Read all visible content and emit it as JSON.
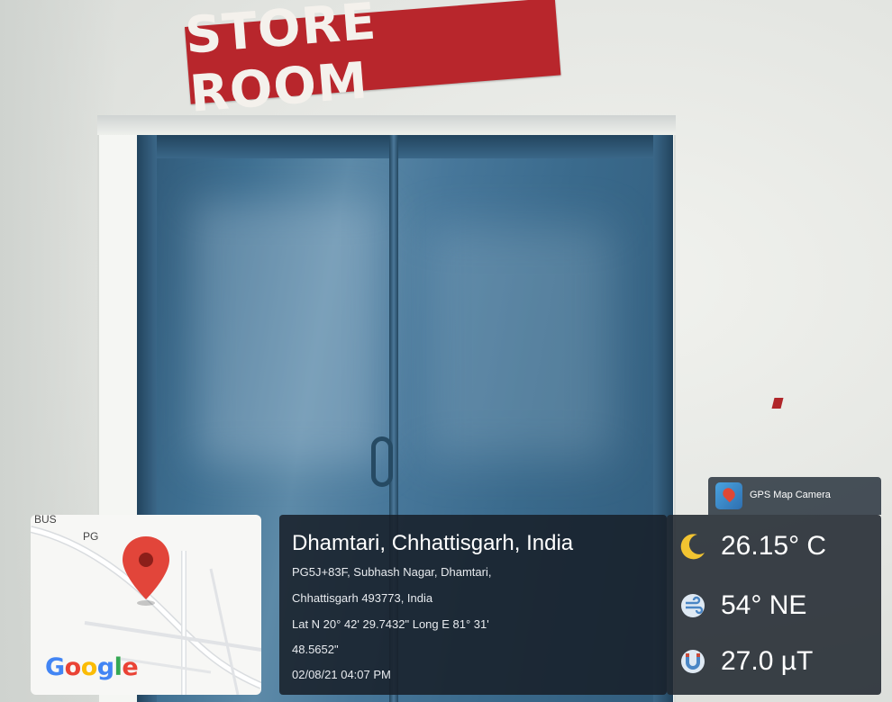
{
  "scene": {
    "sign_text": "STORE ROOM",
    "sign_color": "#b8262c",
    "door_color": "#3e6f91",
    "wall_color": "#e9eae6"
  },
  "map": {
    "labels": [
      "BUS",
      "PG"
    ],
    "brand": "Google",
    "pin_color": "#e2453a"
  },
  "location": {
    "title": "Dhamtari, Chhattisgarh, India",
    "address_line1": "PG5J+83F, Subhash Nagar, Dhamtari,",
    "address_line2": "Chhattisgarh 493773, India",
    "coords_line1": "Lat N 20° 42' 29.7432\" Long E 81° 31'",
    "coords_line2": "48.5652\"",
    "datetime": "02/08/21 04:07 PM"
  },
  "weather": {
    "temperature": "26.15° C",
    "wind": "54° NE",
    "magnetic": "27.0 µT",
    "icons": [
      "moon-icon",
      "wind-icon",
      "magnet-icon"
    ]
  },
  "badge": {
    "app_name": "GPS Map Camera"
  }
}
